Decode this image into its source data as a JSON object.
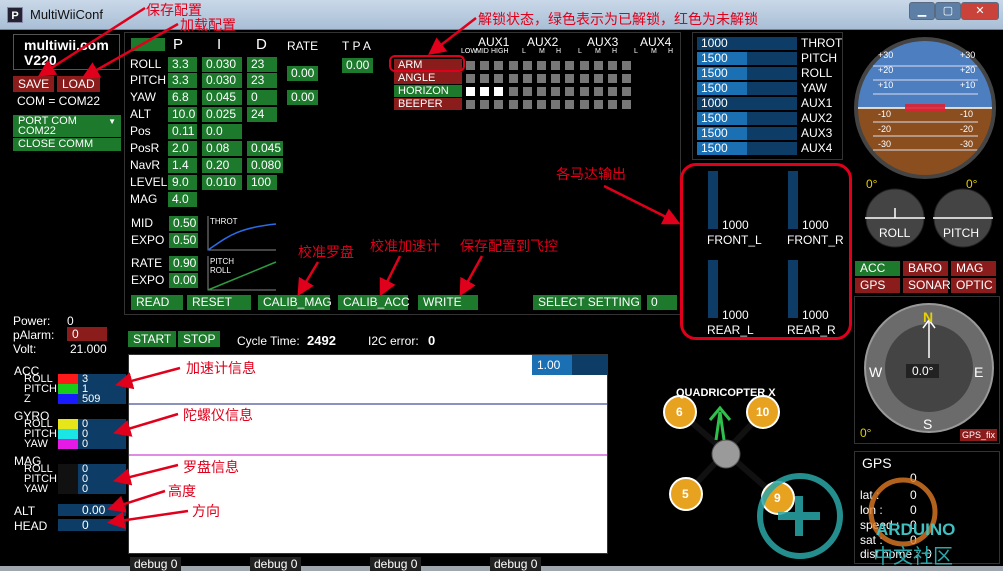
{
  "window": {
    "title": "MultiWiiConf",
    "app_icon": "P"
  },
  "header": {
    "brand": "multiwii.com",
    "version": "V220"
  },
  "conf_buttons": {
    "save": "SAVE",
    "load": "LOAD",
    "com_status": "COM = COM22"
  },
  "port_menu": {
    "label": "PORT COM",
    "item": "COM22",
    "close": "CLOSE COMM"
  },
  "pid": {
    "headers": {
      "p": "P",
      "i": "I",
      "d": "D",
      "rate": "RATE",
      "tpa": "T P A"
    },
    "rows": [
      {
        "name": "ROLL",
        "p": "3.3",
        "i": "0.030",
        "d": "23"
      },
      {
        "name": "PITCH",
        "p": "3.3",
        "i": "0.030",
        "d": "23"
      },
      {
        "name": "YAW",
        "p": "6.8",
        "i": "0.045",
        "d": "0"
      },
      {
        "name": "ALT",
        "p": "10.0",
        "i": "0.025",
        "d": "24"
      },
      {
        "name": "Pos",
        "p": "0.11",
        "i": "0.0",
        "d": ""
      },
      {
        "name": "PosR",
        "p": "2.0",
        "i": "0.08",
        "d": "0.045"
      },
      {
        "name": "NavR",
        "p": "1.4",
        "i": "0.20",
        "d": "0.080"
      },
      {
        "name": "LEVEL",
        "p": "9.0",
        "i": "0.010",
        "d": "100"
      },
      {
        "name": "MAG",
        "p": "4.0",
        "i": "",
        "d": ""
      }
    ],
    "rate_rollpitch": "0.00",
    "rate_yaw": "0.00",
    "tpa": "0.00"
  },
  "expo": {
    "mid_label": "MID",
    "mid": "0.50",
    "expo_label": "EXPO",
    "expo": "0.50",
    "throt_label": "THROT",
    "rate_label": "RATE",
    "rate": "0.90",
    "expo2_label": "EXPO",
    "expo2": "0.00",
    "pitch_label": "PITCH",
    "roll_label": "ROLL"
  },
  "aux": {
    "groups": [
      "AUX1",
      "AUX2",
      "AUX3",
      "AUX4"
    ],
    "sub1": [
      "LOW",
      "MID",
      "HIGH"
    ],
    "sub": [
      "L",
      "M",
      "H"
    ],
    "boxes": [
      "ARM",
      "ANGLE",
      "HORIZON",
      "BEEPER"
    ]
  },
  "bottom_buttons": {
    "read": "READ",
    "reset": "RESET",
    "calib_mag": "CALIB_MAG",
    "calib_acc": "CALIB_ACC",
    "write": "WRITE",
    "select_setting": "SELECT SETTING",
    "setting_value": "0"
  },
  "rc": {
    "labels": [
      "THROT",
      "PITCH",
      "ROLL",
      "YAW",
      "AUX1",
      "AUX2",
      "AUX3",
      "AUX4"
    ],
    "values": [
      "1000",
      "1500",
      "1500",
      "1500",
      "1000",
      "1500",
      "1500",
      "1500"
    ],
    "fill_fraction": [
      0.0,
      0.5,
      0.5,
      0.5,
      0.0,
      0.5,
      0.5,
      0.5
    ]
  },
  "motors": {
    "front_l_value": "1000",
    "front_l": "FRONT_L",
    "front_r_value": "1000",
    "front_r": "FRONT_R",
    "rear_l_value": "1000",
    "rear_l": "REAR_L",
    "rear_r_value": "1000",
    "rear_r": "REAR_R"
  },
  "horizon": {
    "ticks_left": [
      "+30",
      "+20",
      "+10",
      "-10",
      "-20",
      "-30"
    ],
    "ticks_right": [
      "+30",
      "+20",
      "+10",
      "-10",
      "-20",
      "-30"
    ],
    "roll_deg": "0°",
    "pitch_deg": "0°",
    "roll": "ROLL",
    "pitch": "PITCH"
  },
  "sensors": {
    "acc": "ACC",
    "baro": "BARO",
    "mag": "MAG",
    "gps": "GPS",
    "sonar": "SONAR",
    "optic": "OPTIC"
  },
  "compass": {
    "n": "N",
    "s": "S",
    "e": "E",
    "w": "W",
    "heading": "0.0°",
    "deg": "0°",
    "gps_fix": "GPS_fix"
  },
  "gps": {
    "title": "GPS",
    "fix": "0",
    "lat_label": "lat :",
    "lat": "0",
    "lon_label": "lon :",
    "lon": "0",
    "speed_label": "speed :",
    "speed": "0",
    "sat_label": "sat :",
    "sat": "0",
    "dist_label": "dist home :",
    "dist": "0"
  },
  "power": {
    "power_label": "Power:",
    "power": "0",
    "palarm_label": "pAlarm:",
    "palarm": "0",
    "volt_label": "Volt:",
    "volt": "21.000"
  },
  "graph": {
    "start": "START",
    "stop": "STOP",
    "cycle_label": "Cycle Time:",
    "cycle": "2492",
    "i2c_label": "I2C error:",
    "i2c": "0",
    "scale": "1.00"
  },
  "sensor_readout": {
    "acc": "ACC",
    "acc_roll": "3",
    "acc_pitch": "1",
    "acc_z": "509",
    "gyro": "GYRO",
    "gyro_roll": "0",
    "gyro_pitch": "0",
    "gyro_yaw": "0",
    "mag": "MAG",
    "mag_roll": "0",
    "mag_pitch": "0",
    "mag_yaw": "0",
    "alt": "ALT",
    "alt_value": "0.00",
    "head": "HEAD",
    "head_value": "0",
    "roll": "ROLL",
    "pitch": "PITCH",
    "yaw": "YAW",
    "z": "Z"
  },
  "debug": [
    "debug 0",
    "debug 0",
    "debug 0",
    "debug 0"
  ],
  "quad": {
    "label": "QUADRICOPTER X",
    "m1": "6",
    "m2": "10",
    "m3": "5",
    "m4": "9"
  },
  "annotations": {
    "save": "保存配置",
    "load": "加载配置",
    "unlock": "解锁状态，绿色表示为已解锁，红色为未解锁",
    "motors": "各马达输出",
    "calib_mag": "校准罗盘",
    "calib_acc": "校准加速计",
    "write": "保存配置到飞控",
    "acc": "加速计信息",
    "gyro": "陀螺仪信息",
    "mag": "罗盘信息",
    "alt": "高度",
    "head": "方向"
  },
  "watermark": {
    "text1": "ARDUINO",
    "text2": "中文社区"
  },
  "colors": {
    "green": "#1d7a2c",
    "red": "#8b1c1c",
    "blue": "#1b6fb3",
    "annotation": "#e0001b"
  }
}
